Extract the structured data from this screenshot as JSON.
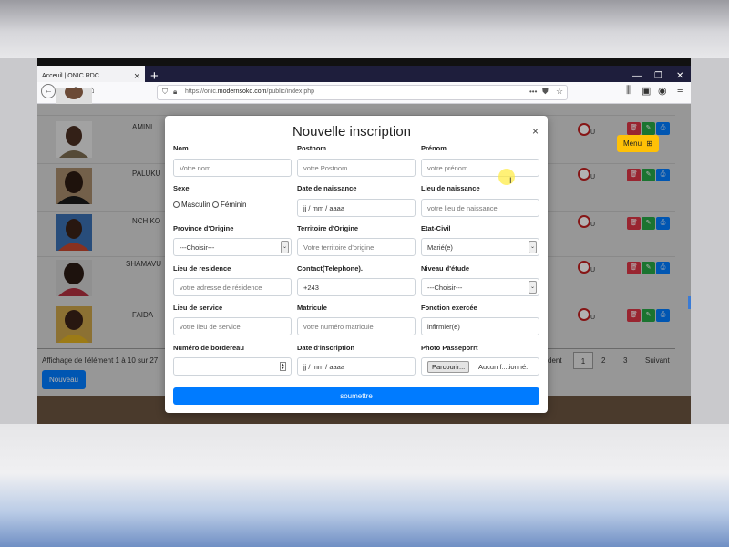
{
  "browser": {
    "tab_title": "Acceuil | ONIC RDC",
    "tab_close": "×",
    "new_tab": "+",
    "win_min": "—",
    "win_max": "❐",
    "win_close": "✕",
    "url_prefix": "https://onic.",
    "url_domain": "modernsoko.com",
    "url_path": "/public/index.php",
    "overflow": "•••"
  },
  "table": {
    "rows": [
      {
        "name": "AMINI"
      },
      {
        "name": "PALUKU"
      },
      {
        "name": "NCHIKO"
      },
      {
        "name": "SHAMAVU"
      },
      {
        "name": "FAIDA"
      }
    ],
    "u_label": "U",
    "info": "Affichage de l'élément 1 à 10 sur 27",
    "new_button": "Nouveau"
  },
  "menu_button": "Menu",
  "pagination": {
    "prev_fragment": "dent",
    "pages": [
      "1",
      "2",
      "3"
    ],
    "next": "Suivant"
  },
  "modal": {
    "title": "Nouvelle inscription",
    "close": "×",
    "fields": {
      "nom": {
        "label": "Nom",
        "placeholder": "Votre nom"
      },
      "postnom": {
        "label": "Postnom",
        "placeholder": "votre Postnom"
      },
      "prenom": {
        "label": "Prénom",
        "placeholder": "votre prénom"
      },
      "sexe": {
        "label": "Sexe",
        "option_m": "Masculin",
        "option_f": "Féminin"
      },
      "date_naissance": {
        "label": "Date de naissance",
        "placeholder": "jj / mm / aaaa"
      },
      "lieu_naissance": {
        "label": "Lieu de naissance",
        "placeholder": "votre lieu de naissance"
      },
      "province": {
        "label": "Province d'Origine",
        "value": "---Choisir---"
      },
      "territoire": {
        "label": "Territoire d'Origine",
        "placeholder": "Votre territoire d'origine"
      },
      "etat_civil": {
        "label": "Etat-Civil",
        "value": "Marié(e)"
      },
      "residence": {
        "label": "Lieu de residence",
        "placeholder": "votre adresse de résidence"
      },
      "contact": {
        "label": "Contact(Telephone).",
        "value": "+243"
      },
      "niveau": {
        "label": "Niveau d'étude",
        "value": "---Choisir---"
      },
      "service": {
        "label": "Lieu de service",
        "placeholder": "votre lieu de service"
      },
      "matricule": {
        "label": "Matricule",
        "placeholder": "votre numéro matricule"
      },
      "fonction": {
        "label": "Fonction exercée",
        "value": "infirmier(e)"
      },
      "bordereau": {
        "label": "Numéro de bordereau",
        "value": ""
      },
      "date_inscription": {
        "label": "Date d'inscription",
        "placeholder": "jj / mm / aaaa"
      },
      "photo": {
        "label": "Photo Passeporrt",
        "button": "Parcourir...",
        "status": "Aucun f...tionné."
      }
    },
    "submit": "soumettre"
  },
  "colors": {
    "primary": "#007bff",
    "danger": "#dc3545",
    "success": "#28a745",
    "warning": "#ffc107"
  }
}
